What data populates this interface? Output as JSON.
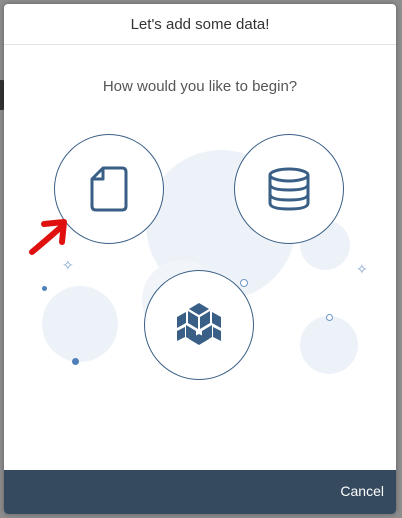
{
  "dialog": {
    "title": "Let's add some data!",
    "prompt": "How would you like to begin?",
    "cancel_label": "Cancel"
  },
  "options": [
    {
      "icon": "document-icon"
    },
    {
      "icon": "database-icon"
    },
    {
      "icon": "cube-cluster-icon"
    }
  ],
  "colors": {
    "footer": "#354a5f",
    "icon": "#3a5f86",
    "accent_annotation": "#e01010"
  }
}
